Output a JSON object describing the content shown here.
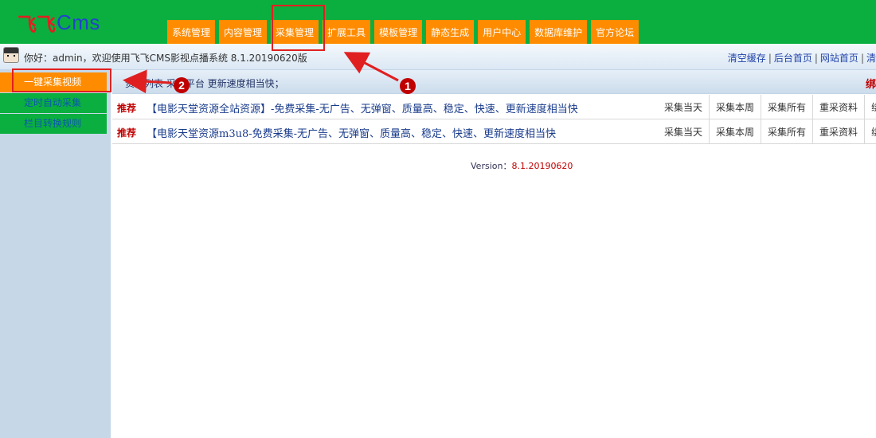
{
  "app": {
    "logo_mark": "飞飞",
    "logo_text": "Cms"
  },
  "nav": {
    "items": [
      {
        "label": "系统管理"
      },
      {
        "label": "内容管理"
      },
      {
        "label": "采集管理"
      },
      {
        "label": "扩展工具"
      },
      {
        "label": "模板管理"
      },
      {
        "label": "静态生成"
      },
      {
        "label": "用户中心"
      },
      {
        "label": "数据库维护"
      },
      {
        "label": "官方论坛"
      }
    ],
    "active_index": 2
  },
  "topbar": {
    "welcome": "你好：admin，欢迎使用飞飞CMS影视点播系统 8.1.20190620版",
    "links": [
      "清空缓存",
      "后台首页",
      "网站首页",
      "清"
    ]
  },
  "sidebar": {
    "items": [
      {
        "label": "一键采集视频"
      },
      {
        "label": "定时自动采集"
      },
      {
        "label": "栏目转换规则"
      }
    ]
  },
  "notice": {
    "text": "资源列表 采集平台 更新速度相当快；",
    "right": "绑"
  },
  "resources": [
    {
      "tag": "推荐",
      "title": "【电影天堂资源全站资源】-免费采集-无广告、无弹窗、质量高、稳定、快速、更新速度相当快",
      "actions": [
        "采集当天",
        "采集本周",
        "采集所有",
        "重采资料",
        "绑"
      ]
    },
    {
      "tag": "推荐",
      "title": "【电影天堂资源m3u8-免费采集-无广告、无弹窗、质量高、稳定、快速、更新速度相当快",
      "actions": [
        "采集当天",
        "采集本周",
        "采集所有",
        "重采资料",
        "绑"
      ]
    }
  ],
  "footer": {
    "version_label": "Version：",
    "version_value": "8.1.20190620"
  },
  "annotations": {
    "badge1": "1",
    "badge2": "2",
    "color": "#e02020"
  },
  "colors": {
    "header_green": "#0aaf3f",
    "nav_orange": "#ff8c00",
    "sidebar_blue": "#c6d8e8"
  }
}
